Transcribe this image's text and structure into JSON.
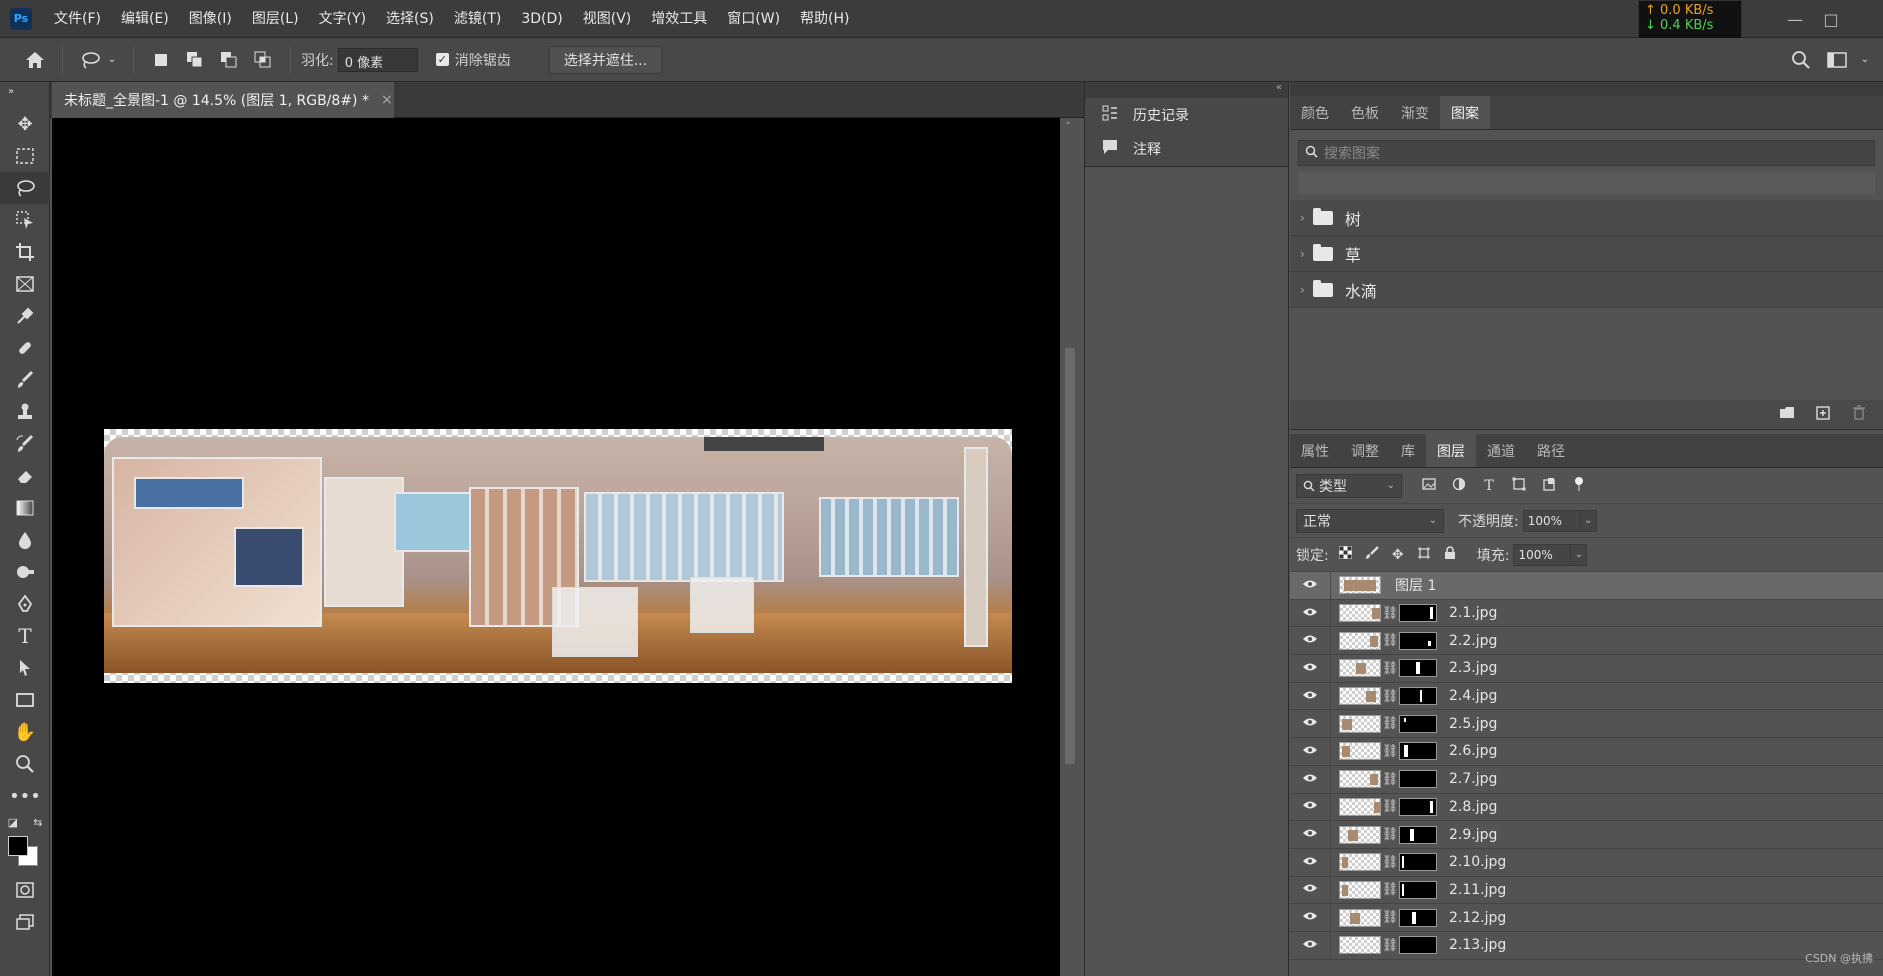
{
  "menubar": {
    "logo": "Ps",
    "items": [
      "文件(F)",
      "编辑(E)",
      "图像(I)",
      "图层(L)",
      "文字(Y)",
      "选择(S)",
      "滤镜(T)",
      "3D(D)",
      "视图(V)",
      "增效工具",
      "窗口(W)",
      "帮助(H)"
    ]
  },
  "netspeed": {
    "up": "↑ 0.0 KB/s",
    "down": "↓ 0.4 KB/s"
  },
  "options": {
    "feather_label": "羽化:",
    "feather_value": "0 像素",
    "antialias_label": "消除锯齿",
    "antialias_checked": true,
    "select_mask_button": "选择并遮住..."
  },
  "document": {
    "tab_title": "未标题_全景图-1 @ 14.5% (图层 1, RGB/8#) *",
    "close": "×"
  },
  "mid_panel": {
    "items": [
      {
        "icon": "history-icon",
        "label": "历史记录"
      },
      {
        "icon": "notes-icon",
        "label": "注释"
      }
    ]
  },
  "pattern_panel": {
    "tabs": [
      "颜色",
      "色板",
      "渐变",
      "图案"
    ],
    "active_tab": "图案",
    "search_placeholder": "搜索图案",
    "groups": [
      "树",
      "草",
      "水滴"
    ]
  },
  "layers_panel": {
    "tabs": [
      "属性",
      "调整",
      "库",
      "图层",
      "通道",
      "路径"
    ],
    "active_tab": "图层",
    "filter_kind": "类型",
    "blend_mode": "正常",
    "opacity_label": "不透明度:",
    "opacity_value": "100%",
    "lock_label": "锁定:",
    "fill_label": "填充:",
    "fill_value": "100%",
    "layers": [
      {
        "name": "图层 1",
        "selected": true,
        "has_mask": false
      },
      {
        "name": "2.1.jpg",
        "selected": false,
        "has_mask": true
      },
      {
        "name": "2.2.jpg",
        "selected": false,
        "has_mask": true
      },
      {
        "name": "2.3.jpg",
        "selected": false,
        "has_mask": true
      },
      {
        "name": "2.4.jpg",
        "selected": false,
        "has_mask": true
      },
      {
        "name": "2.5.jpg",
        "selected": false,
        "has_mask": true
      },
      {
        "name": "2.6.jpg",
        "selected": false,
        "has_mask": true
      },
      {
        "name": "2.7.jpg",
        "selected": false,
        "has_mask": true
      },
      {
        "name": "2.8.jpg",
        "selected": false,
        "has_mask": true
      },
      {
        "name": "2.9.jpg",
        "selected": false,
        "has_mask": true
      },
      {
        "name": "2.10.jpg",
        "selected": false,
        "has_mask": true
      },
      {
        "name": "2.11.jpg",
        "selected": false,
        "has_mask": true
      },
      {
        "name": "2.12.jpg",
        "selected": false,
        "has_mask": true
      },
      {
        "name": "2.13.jpg",
        "selected": false,
        "has_mask": true
      }
    ]
  },
  "watermark": "CSDN @执拂"
}
